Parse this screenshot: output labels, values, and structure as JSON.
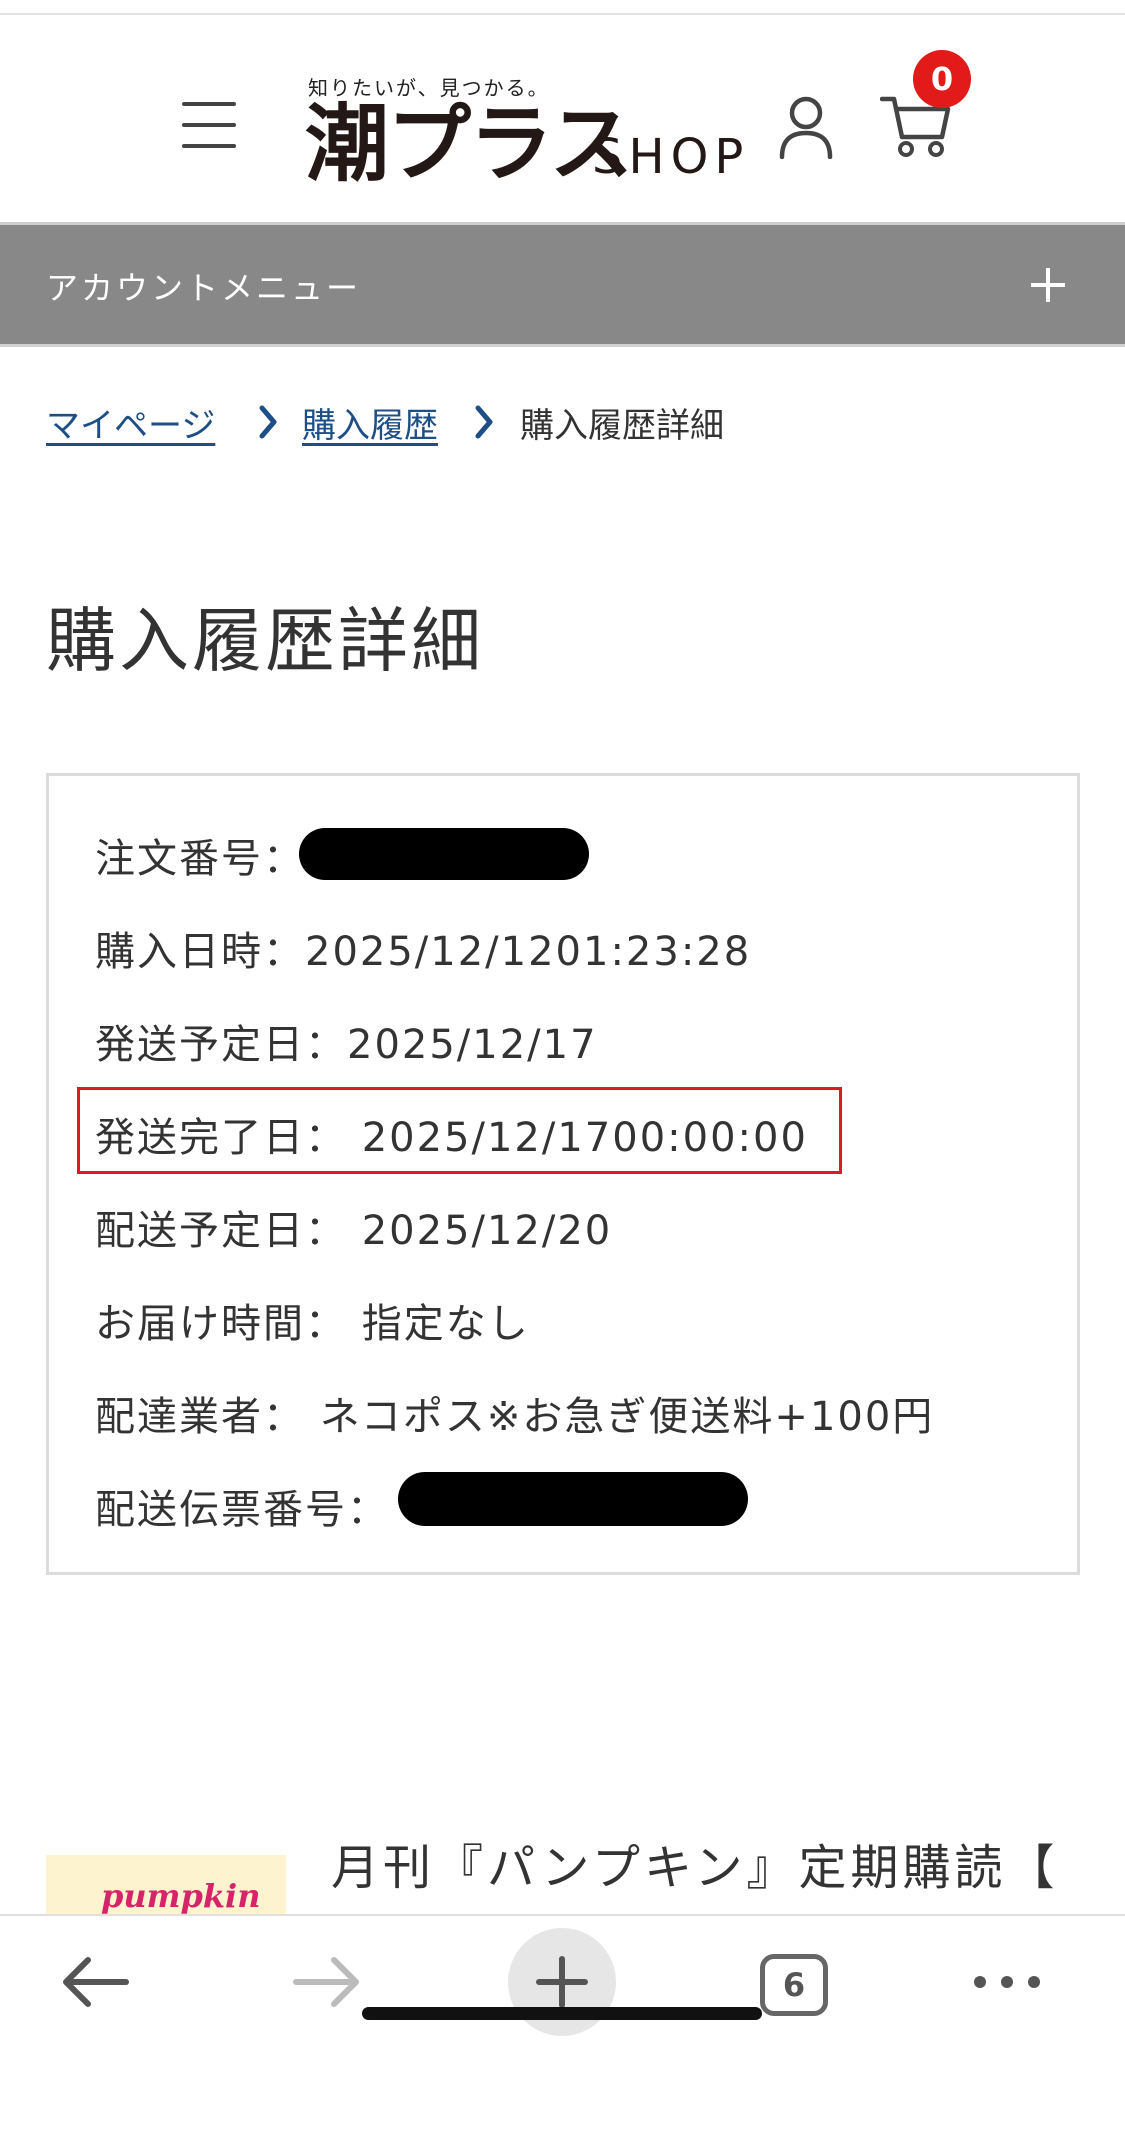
{
  "header": {
    "logo_tagline": "知りたいが、見つかる。",
    "logo_main": "潮プラス",
    "logo_shop": "SHOP",
    "cart_count": "0"
  },
  "account_menu": {
    "label": "アカウントメニュー"
  },
  "breadcrumb": {
    "items": [
      "マイページ",
      "購入履歴"
    ],
    "current": "購入履歴詳細"
  },
  "page_title": "購入履歴詳細",
  "order": {
    "order_number_label": "注文番号：",
    "purchase_datetime": "購入日時：2025/12/1201:23:28",
    "scheduled_ship_date": "発送予定日：2025/12/17",
    "shipped_date": "発送完了日： 2025/12/1700:00:00",
    "scheduled_delivery_date": "配送予定日： 2025/12/20",
    "delivery_time": "お届け時間： 指定なし",
    "carrier": "配達業者： ネコポス※お急ぎ便送料+100円",
    "tracking_number_label": "配送伝票番号："
  },
  "product": {
    "thumb_text": "pumpkin",
    "title": "月刊『パンプキン』定期購読【"
  },
  "browser": {
    "tabs_count": "6"
  },
  "colors": {
    "menu_bar": "#888888",
    "link": "#1d4f86",
    "highlight": "#d71c25",
    "badge": "#e21a1a"
  }
}
